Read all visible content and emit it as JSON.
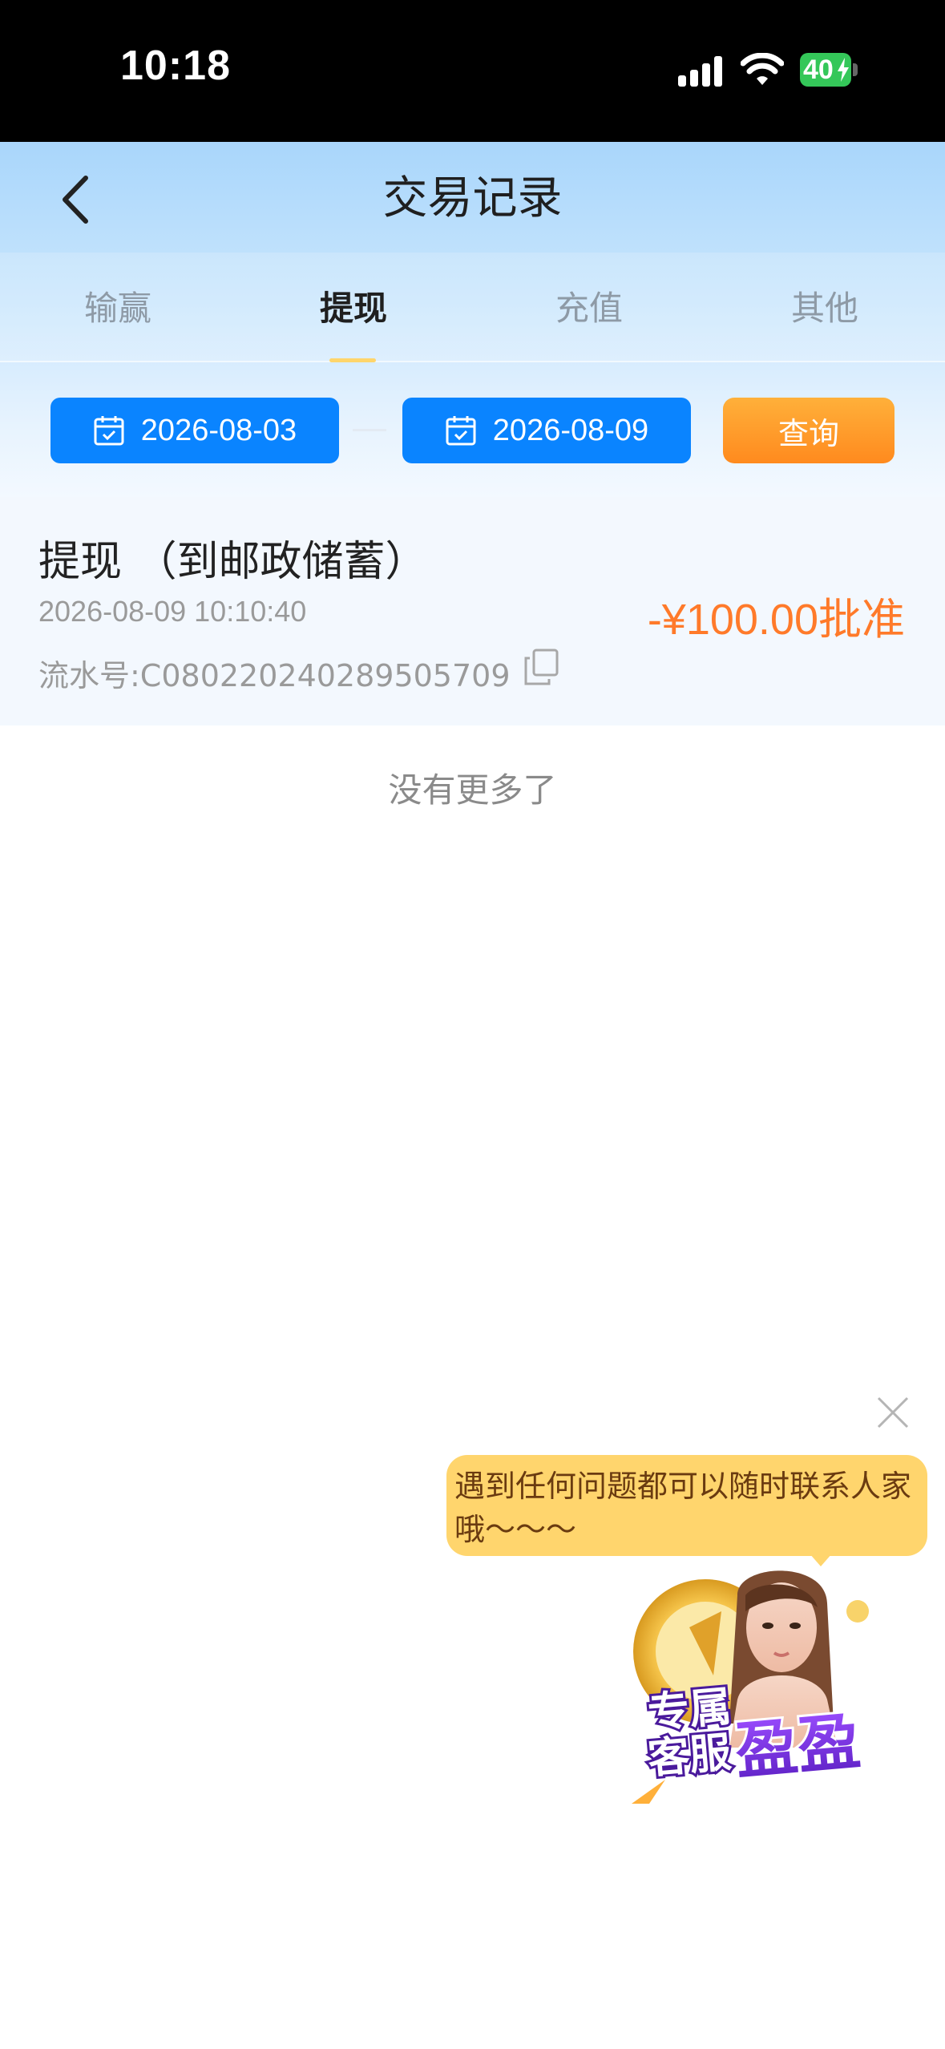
{
  "status_bar": {
    "time": "10:18",
    "battery": "40",
    "icons": [
      "signal-icon",
      "wifi-icon",
      "battery-icon",
      "charging-bolt-icon"
    ]
  },
  "nav": {
    "back_icon": "chevron-left-icon",
    "title": "交易记录"
  },
  "tabs": [
    {
      "label": "输赢",
      "active": false
    },
    {
      "label": "提现",
      "active": true
    },
    {
      "label": "充值",
      "active": false
    },
    {
      "label": "其他",
      "active": false
    }
  ],
  "filter": {
    "start_date": "2026-08-03",
    "end_date": "2026-08-09",
    "calendar_icon": "calendar-icon",
    "query_label": "查询"
  },
  "records": [
    {
      "title": "提现 （到邮政储蓄）",
      "time": "2026-08-09 10:10:40",
      "serial": "流水号:C080220240289505709",
      "amount": "-¥100.00批准",
      "copy_icon": "copy-icon"
    }
  ],
  "list_end": "没有更多了",
  "support": {
    "message": "遇到任何问题都可以随时联系人家哦～～～",
    "badge_line1": "专属",
    "badge_line2": "客服",
    "badge_name": "盈盈",
    "close_icon": "close-icon"
  },
  "colors": {
    "primary_blue": "#0A84FF",
    "query_orange": "#FF8A1E",
    "amount_orange": "#FF7A2A",
    "bubble_yellow": "#FFD56D"
  }
}
